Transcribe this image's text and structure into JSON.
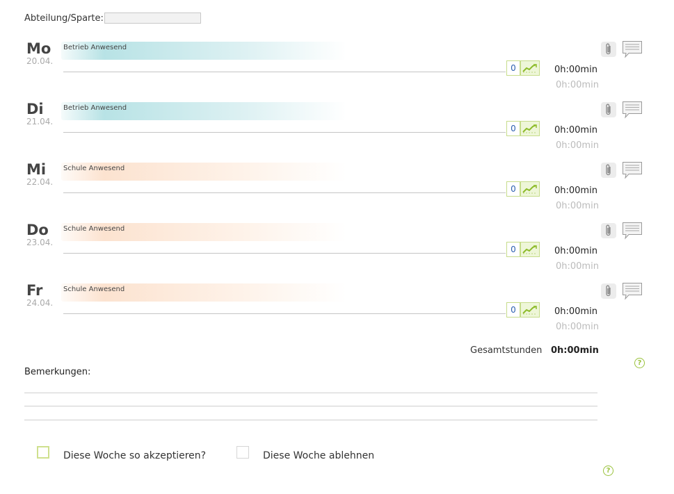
{
  "header": {
    "department_label": "Abteilung/Sparte:",
    "department_value": ""
  },
  "days": [
    {
      "abbr": "Mo",
      "date": "20.04.",
      "status": "Betrieb Anwesend",
      "status_type": "betrieb",
      "count": "0",
      "time": "0h:00min",
      "time_sub": "0h:00min"
    },
    {
      "abbr": "Di",
      "date": "21.04.",
      "status": "Betrieb Anwesend",
      "status_type": "betrieb",
      "count": "0",
      "time": "0h:00min",
      "time_sub": "0h:00min"
    },
    {
      "abbr": "Mi",
      "date": "22.04.",
      "status": "Schule Anwesend",
      "status_type": "schule",
      "count": "0",
      "time": "0h:00min",
      "time_sub": "0h:00min"
    },
    {
      "abbr": "Do",
      "date": "23.04.",
      "status": "Schule Anwesend",
      "status_type": "schule",
      "count": "0",
      "time": "0h:00min",
      "time_sub": "0h:00min"
    },
    {
      "abbr": "Fr",
      "date": "24.04.",
      "status": "Schule Anwesend",
      "status_type": "schule",
      "count": "0",
      "time": "0h:00min",
      "time_sub": "0h:00min"
    }
  ],
  "totals": {
    "label": "Gesamtstunden",
    "value": "0h:00min"
  },
  "remarks": {
    "label": "Bemerkungen:"
  },
  "actions": {
    "accept_label": "Diese Woche so akzeptieren?",
    "reject_label": "Diese Woche ablehnen"
  },
  "help_glyph": "?",
  "colors": {
    "accent_green": "#9ac23c",
    "betrieb_band": "#b4e1e4",
    "schule_band": "#fce1cd",
    "count_blue": "#2b5fb0"
  },
  "icons": {
    "attachment": "paperclip-icon",
    "comment": "comment-icon",
    "trend": "trend-chart-icon",
    "help": "help-icon"
  }
}
